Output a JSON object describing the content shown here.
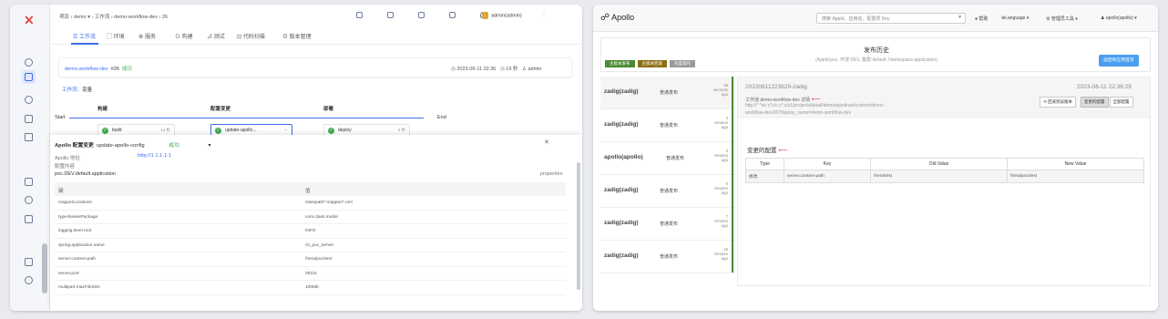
{
  "left": {
    "header": {
      "breadcrumb": [
        "项目",
        "demo",
        "工作流",
        "demo-workflow-dev",
        "26"
      ],
      "user": "admin(admin)"
    },
    "tabs": [
      {
        "label": "工作流",
        "icon": "workflow-icon"
      },
      {
        "label": "环境",
        "icon": "environment-icon"
      },
      {
        "label": "服务",
        "icon": "service-icon"
      },
      {
        "label": "构建",
        "icon": "build-icon"
      },
      {
        "label": "测试",
        "icon": "test-icon"
      },
      {
        "label": "代码扫描",
        "icon": "scan-icon"
      },
      {
        "label": "版本管理",
        "icon": "version-icon"
      }
    ],
    "task": {
      "name": "demo-workflow-dev",
      "number": "#26",
      "status": "成功",
      "time": "2023-06-11 22:36",
      "duration": "19 秒",
      "user": "admin"
    },
    "workflow_label": "工作流：",
    "workflow_value": "变量",
    "pipeline": {
      "start": "Start",
      "end": "End",
      "stages": [
        {
          "title": "构建",
          "job": "build",
          "duration": "14 秒"
        },
        {
          "title": "配置变更",
          "job": "update-apollo...",
          "duration": ""
        },
        {
          "title": "部署",
          "job": "deploy",
          "duration": "3 秒"
        }
      ]
    },
    "detail": {
      "title": "Apollo 配置变更",
      "job": "update-apollo-config",
      "status": "成功",
      "apollo_addr_label": "Apollo 地址",
      "apollo_addr": "http://1 1.1.1:1",
      "config_label": "配置内容",
      "namespace": "poc.DEV.default.application",
      "format": "properties",
      "col_key": "键",
      "col_value": "值",
      "rows": [
        [
          "mapperLocations",
          "classpath*:mapper/*.xml"
        ],
        [
          "typeAliasesPackage",
          "com.class.model"
        ],
        [
          "logging.level.root",
          "INFO"
        ],
        [
          "spring.application.name",
          "cit_poc_server"
        ],
        [
          "server.context-path",
          "/hera/poc/test"
        ],
        [
          "server.port",
          "20211"
        ],
        [
          "multipart.maxFileSize",
          "100Mb"
        ]
      ]
    },
    "sidebar_icons": [
      "home-icon",
      "project-icon",
      "environment-icon",
      "service-icon",
      "workflow-icon",
      "data-icon",
      "delivery-icon",
      "monitor-icon",
      "settings-icon",
      "stats-icon"
    ]
  },
  "right": {
    "brand": "Apollo",
    "search_placeholder": "搜索 AppId、应用名、配置项 Key",
    "nav": [
      "帮助",
      "Language",
      "管理员工具",
      "apollo(apollo)"
    ],
    "page_title": "发布历史",
    "page_subtitle": "(AppId:poc, 环境:DEV, 集群:default, Namespace:application)",
    "legend": [
      "主版本发布",
      "主版本回滚",
      "灰度操作"
    ],
    "back_button": "返回到应用首页",
    "history": [
      {
        "user": "zadig(zadig)",
        "type": "普通发布",
        "ago": [
          "58",
          "seconds",
          "ago"
        ]
      },
      {
        "user": "zadig(zadig)",
        "type": "普通发布",
        "ago": [
          "2",
          "minutes",
          "ago"
        ]
      },
      {
        "user": "apollo(apollo)",
        "type": "普通发布",
        "ago": [
          "3",
          "minutes",
          "ago"
        ]
      },
      {
        "user": "zadig(zadig)",
        "type": "普通发布",
        "ago": [
          "5",
          "minutes",
          "ago"
        ]
      },
      {
        "user": "zadig(zadig)",
        "type": "普通发布",
        "ago": [
          "7",
          "minutes",
          "ago"
        ]
      },
      {
        "user": "zadig(zadig)",
        "type": "普通发布",
        "ago": [
          "16",
          "minutes",
          "ago"
        ]
      }
    ],
    "release": {
      "id": "20230611223629-zadig",
      "datetime": "2023-06-11 22:36:29",
      "comment_line1": "工作流 demo-workflow-dev 详情",
      "comment_line2": "http://* *ac·c*c/c c*:c/v1/projects/detail/demo/pipelines/custom/demo-",
      "comment_line3": "workflow-dev/26?display_name=demo-workflow-dev",
      "btn_rollback": "回滚到该版本",
      "btn_changed": "变更的配置",
      "btn_all": "全部配置"
    },
    "changes": {
      "title": "变更的配置",
      "headers": [
        "Type",
        "Key",
        "Old Value",
        "New Value"
      ],
      "rows": [
        [
          "修改",
          "server.context-path",
          "/hera/test",
          "/hera/poc/test"
        ]
      ]
    }
  },
  "colors": {
    "accent": "#3f6bf0",
    "success": "#3dad55",
    "apollo_blue": "#4b9ff1",
    "apollo_green": "#4a8a33"
  }
}
